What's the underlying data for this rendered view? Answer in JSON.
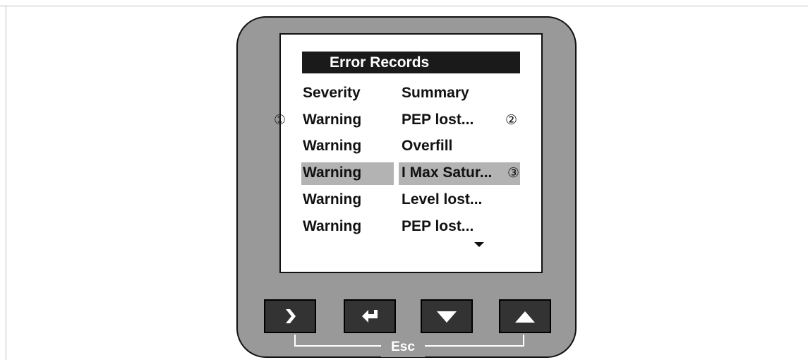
{
  "screen": {
    "title": "Error Records",
    "headers": {
      "severity": "Severity",
      "summary": "Summary"
    },
    "rows": [
      {
        "severity": "Warning",
        "summary": "PEP lost..."
      },
      {
        "severity": "Warning",
        "summary": "Overfill"
      },
      {
        "severity": "Warning",
        "summary": "I Max Satur..."
      },
      {
        "severity": "Warning",
        "summary": "Level lost..."
      },
      {
        "severity": "Warning",
        "summary": "PEP lost..."
      }
    ],
    "selected_row_index": 2,
    "scroll_indicator": "down-triangle"
  },
  "callouts": {
    "c1": "①",
    "c2": "②",
    "c3": "③"
  },
  "keypad": {
    "keys": [
      {
        "name": "right",
        "icon": "chevron-right-icon"
      },
      {
        "name": "enter",
        "icon": "enter-arrow-icon"
      },
      {
        "name": "down",
        "icon": "triangle-down-icon"
      },
      {
        "name": "up",
        "icon": "triangle-up-icon"
      }
    ],
    "esc_label": "Esc"
  },
  "colors": {
    "housing": "#999999",
    "keys": "#333333",
    "title_bar": "#1a1a1a",
    "highlight": "#b3b3b3"
  }
}
